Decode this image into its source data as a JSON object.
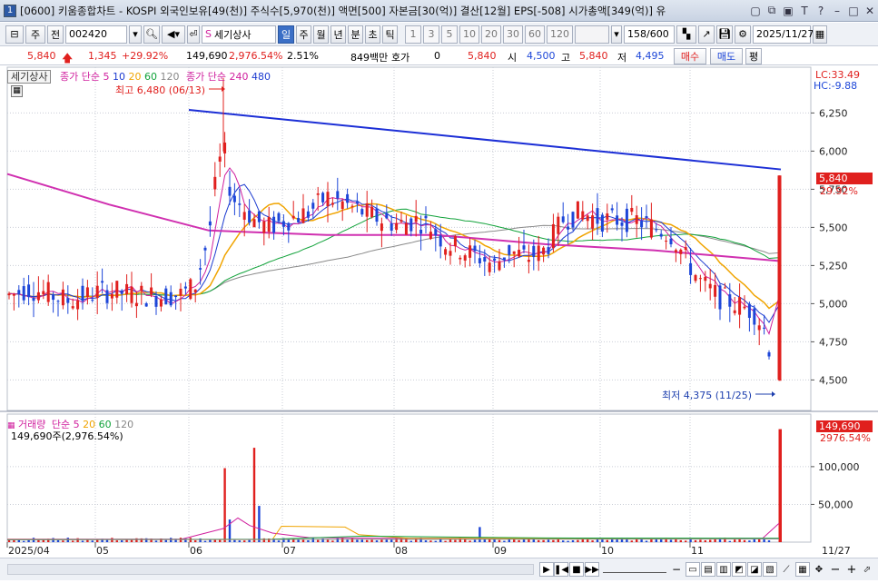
{
  "window": {
    "number_badge": "1",
    "title": "[0600] 키움종합차트 - KOSPI 외국인보유[49(천)] 주식수[5,970(천)] 액면[500] 자본금[30(억)] 결산[12월] EPS[-508] 시가총액[349(억)] 유"
  },
  "toolbar": {
    "period_label": "주",
    "prev_label": "전",
    "stock_code": "002420",
    "stock_name": "세기상사",
    "periods": [
      "일",
      "주",
      "월",
      "년",
      "분",
      "초",
      "틱"
    ],
    "active_period": "일",
    "minute_options": [
      "1",
      "3",
      "5",
      "10",
      "20",
      "30",
      "60",
      "120"
    ],
    "count": "158",
    "count_max": "/600",
    "date": "2025/11/27"
  },
  "quote": {
    "price": "5,840",
    "change": "1,345",
    "change_rate": "+29.92%",
    "volume": "149,690",
    "volume_rate": "2,976.54%",
    "turnover": "2.51%",
    "amount": "849백만",
    "hoga_label": "호가",
    "hoga_value": "0",
    "hoga_price": "5,840",
    "open_label": "시",
    "open": "4,500",
    "high_label": "고",
    "high": "5,840",
    "low_label": "저",
    "low": "4,495",
    "buy_label": "매수",
    "sell_label": "매도",
    "eval_label": "평"
  },
  "price_panel": {
    "stock_label": "세기상사",
    "legend_prefix": "종가 단순",
    "ma_periods": [
      "5",
      "10",
      "20",
      "60",
      "120"
    ],
    "ma_colors": [
      "#d0209e",
      "#1c3bd0",
      "#f0a400",
      "#11a23a",
      "#888888"
    ],
    "legend2_prefix": "종가 단순",
    "ma_long": [
      "240",
      "480"
    ],
    "ma_long_colors": [
      "#d0209e",
      "#1c3bd0"
    ],
    "lc": "LC:33.49",
    "hc": "HC:-9.88",
    "high_annotation": "최고 6,480 (06/13)",
    "low_annotation": "최저 4,375 (11/25)",
    "last_price_tag": "5,840",
    "last_rate_tag": "29.92%",
    "y_ticks": [
      "6,250",
      "6,000",
      "5,750",
      "5,500",
      "5,250",
      "5,000",
      "4,750",
      "4,500"
    ]
  },
  "volume_panel": {
    "legend_label": "거래량",
    "legend_prefix": "단순",
    "ma_periods": [
      "5",
      "20",
      "60",
      "120"
    ],
    "ma_colors": [
      "#d0209e",
      "#f0a400",
      "#11a23a",
      "#888888"
    ],
    "volume_text": "149,690주(2,976.54%)",
    "last_volume_tag": "149,690",
    "last_rate_tag": "2976.54%",
    "y_ticks": [
      "100,000",
      "50,000"
    ]
  },
  "x_axis": {
    "labels": [
      "2025/04",
      "05",
      "06",
      "07",
      "08",
      "09",
      "10",
      "11"
    ],
    "right_label": "11/27"
  },
  "colors": {
    "up": "#e0201e",
    "down": "#1d46d8",
    "trend": "#1c2fd6",
    "ma240": "#d030b0"
  },
  "chart_data": {
    "type": "candlestick",
    "series_note": "daily OHLC, Apr–Nov 2025",
    "y_range": [
      4375,
      6480
    ],
    "high_point": {
      "date": "06/13",
      "value": 6480
    },
    "low_point": {
      "date": "11/25",
      "value": 4375
    },
    "last": {
      "date": "11/27",
      "open": 4500,
      "high": 5840,
      "low": 4495,
      "close": 5840,
      "volume": 149690
    },
    "volume_ticks": [
      50000,
      100000
    ]
  }
}
